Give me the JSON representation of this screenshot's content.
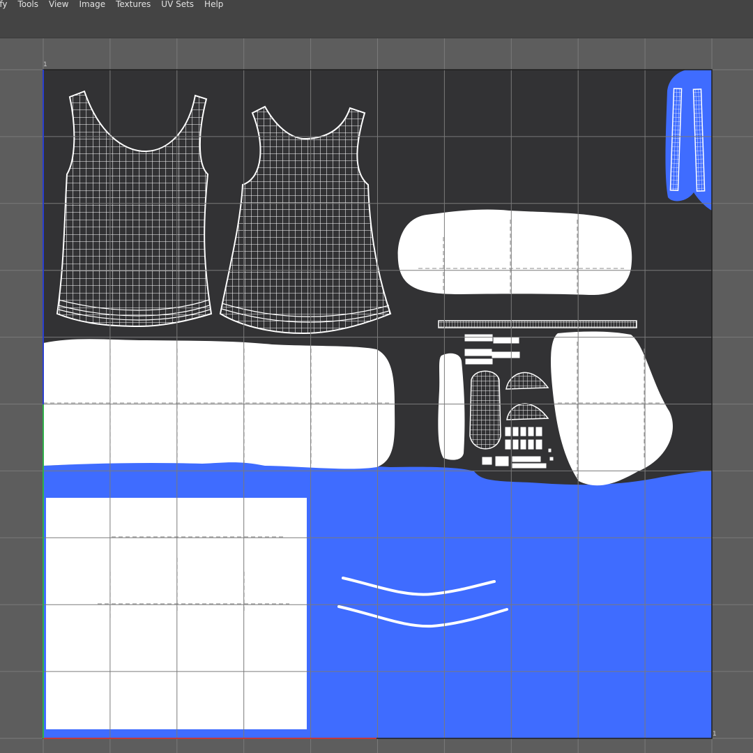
{
  "menubar": {
    "items": [
      {
        "label": "ify",
        "name": "menu-modify"
      },
      {
        "label": "Tools",
        "name": "menu-tools"
      },
      {
        "label": "View",
        "name": "menu-view"
      },
      {
        "label": "Image",
        "name": "menu-image"
      },
      {
        "label": "Textures",
        "name": "menu-textures"
      },
      {
        "label": "UV Sets",
        "name": "menu-uv-sets"
      },
      {
        "label": "Help",
        "name": "menu-help"
      }
    ]
  },
  "uv_editor": {
    "corner_top_left": "1",
    "corner_bottom_right": "1",
    "colors": {
      "background": "#5d5d5d",
      "tile": "#323234",
      "grid_line": "#7a7a7a",
      "uv_selected": "#ffffff",
      "texture_blue": "#3f6cff",
      "axis_u": "#c23a3a",
      "axis_v": "#2fb04a",
      "menubar": "#444444"
    }
  }
}
